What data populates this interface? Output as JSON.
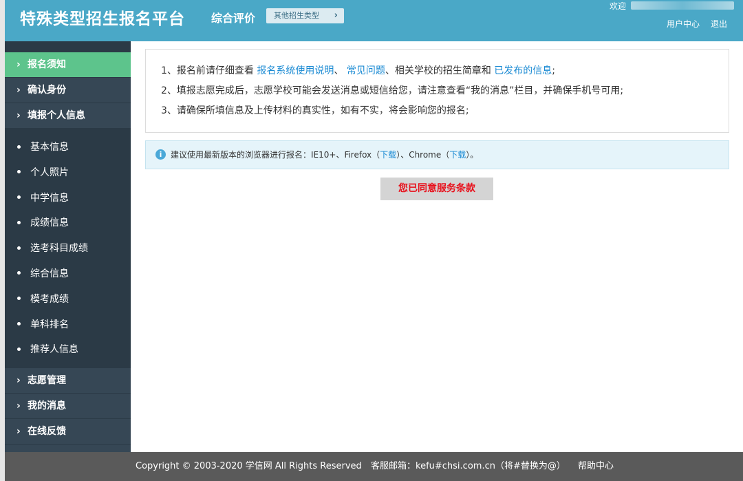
{
  "header": {
    "brand": "特殊类型招生报名平台",
    "subtitle": "综合评价",
    "other_types": "其他招生类型",
    "welcome": "欢迎",
    "user_center": "用户中心",
    "logout": "退出"
  },
  "sidebar": {
    "items_top": [
      {
        "label": "报名须知",
        "active": true
      },
      {
        "label": "确认身份"
      },
      {
        "label": "填报个人信息"
      }
    ],
    "sub_items": [
      {
        "label": "基本信息"
      },
      {
        "label": "个人照片"
      },
      {
        "label": "中学信息"
      },
      {
        "label": "成绩信息"
      },
      {
        "label": "选考科目成绩"
      },
      {
        "label": "综合信息"
      },
      {
        "label": "模考成绩"
      },
      {
        "label": "单科排名"
      },
      {
        "label": "推荐人信息"
      }
    ],
    "items_bottom": [
      {
        "label": "志愿管理"
      },
      {
        "label": "我的消息"
      },
      {
        "label": "在线反馈"
      }
    ]
  },
  "notice": {
    "line1_prefix": "1、报名前请仔细查看",
    "line1_link1": "报名系统使用说明",
    "line1_sep": "、",
    "line1_link2": "常见问题",
    "line1_mid": "、相关学校的招生简章和",
    "line1_link3": "已发布的信息",
    "line1_suffix": ";",
    "line2": "2、填报志愿完成后，志愿学校可能会发送消息或短信给您，请注意查看“我的消息”栏目，并确保手机号可用;",
    "line3": "3、请确保所填信息及上传材料的真实性，如有不实，将会影响您的报名;"
  },
  "tip": {
    "text1": "建议使用最新版本的浏览器进行报名：IE10+、Firefox（",
    "download1": "下载",
    "text2": "）、Chrome（",
    "download2": "下载",
    "text3": "）。"
  },
  "agree_button": "您已同意服务条款",
  "footer": {
    "copyright": "Copyright © 2003-2020 学信网 All Rights Reserved",
    "email": "客服邮箱：kefu#chsi.com.cn（将#替换为@）",
    "help": "帮助中心"
  }
}
